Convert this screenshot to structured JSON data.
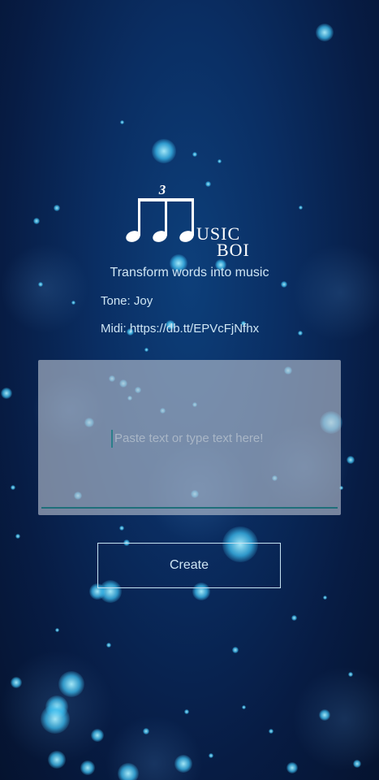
{
  "app": {
    "logo_line1": "USIC",
    "logo_line2": "BOI",
    "logo_triplet": "3",
    "subtitle": "Transform words into music"
  },
  "info": {
    "tone": "Tone: Joy",
    "midi": "Midi: https://db.tt/EPVcFjNfhx"
  },
  "input": {
    "value": "",
    "placeholder": "Paste text or type text here!"
  },
  "actions": {
    "create_label": "Create"
  },
  "colors": {
    "background_top": "#0a2e63",
    "background_bottom": "#05132f",
    "accent_underline": "#1f6f7a",
    "text": "#cfe6f4"
  },
  "icons": {
    "logo": "music-notes-triplet-icon"
  }
}
